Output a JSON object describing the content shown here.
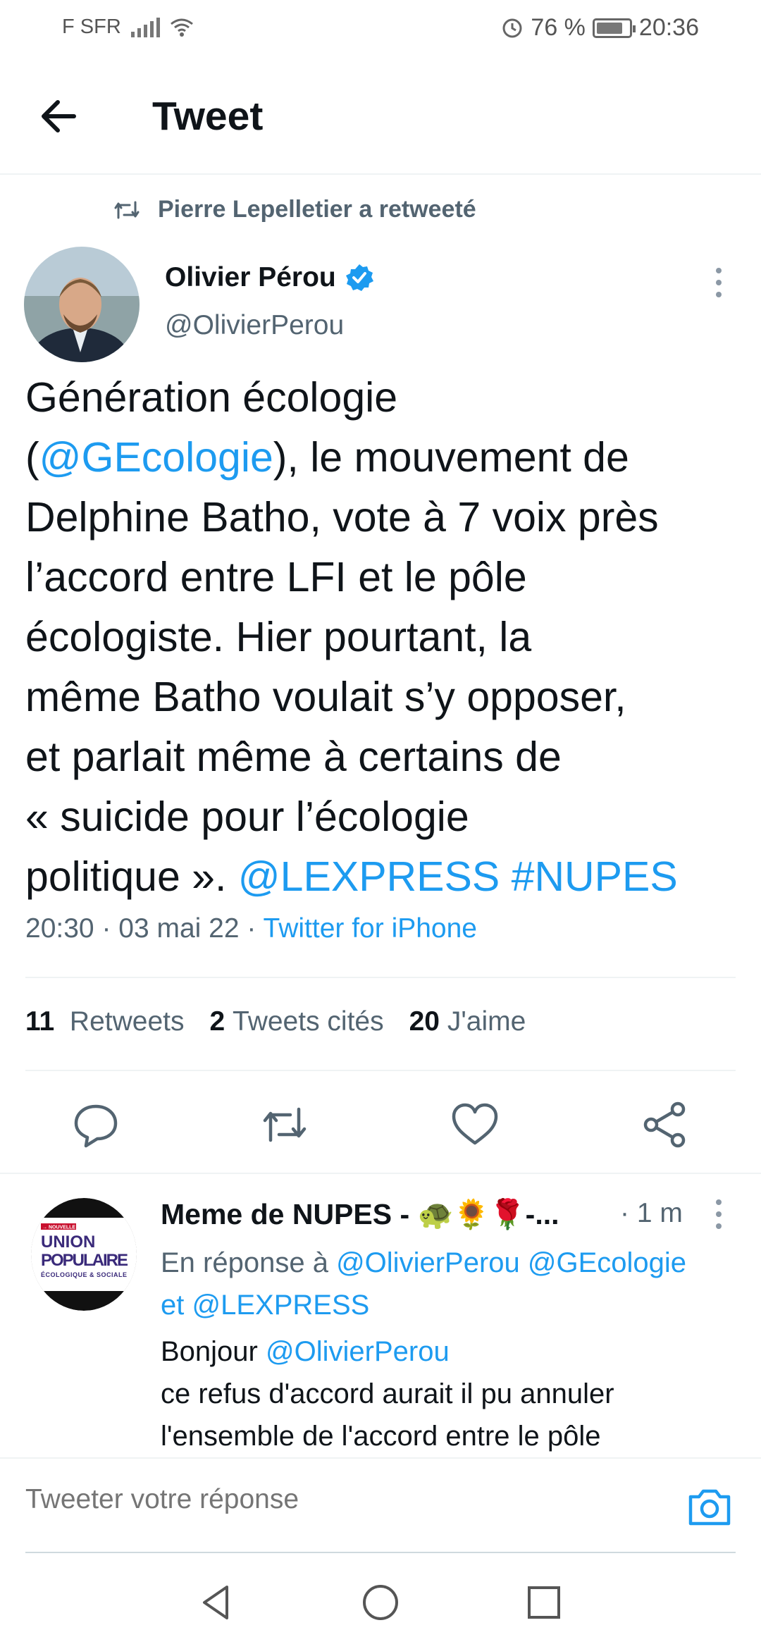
{
  "status_bar": {
    "carrier": "F SFR",
    "battery_percent": "76 %",
    "time": "20:36",
    "battery_level": 0.76
  },
  "header": {
    "title": "Tweet"
  },
  "retweet_line": "Pierre Lepelletier a retweeté",
  "tweet": {
    "author_name": "Olivier Pérou",
    "author_handle": "@OlivierPerou",
    "text_parts": {
      "p1": "Génération écologie",
      "p2": "(",
      "mention_ge": "@GEcologie",
      "p3": "), le mouvement de",
      "p4": "Delphine Batho, vote à 7 voix près",
      "p5": "l’accord entre LFI et le pôle",
      "p6": "écologiste. Hier pourtant, la",
      "p7": "même Batho voulait s’y opposer,",
      "p8": "et parlait même à certains de",
      "p9": "« suicide pour l’écologie",
      "p10": "politique ». ",
      "mention_lexpress": "@LEXPRESS",
      "hashtag": "#NUPES"
    },
    "time": "20:30",
    "date": "03 mai 22",
    "source": "Twitter for iPhone"
  },
  "stats": {
    "retweets_count": "11",
    "retweets_label": "Retweets",
    "quotes_count": "2",
    "quotes_label": "Tweets cités",
    "likes_count": "20",
    "likes_label": "J'aime"
  },
  "reply": {
    "author_display": "Meme de NUPES - 🐢🌻🌹-...",
    "time": "· 1 m",
    "reply_to_prefix": "En réponse à",
    "reply_to_m1": "@OlivierPerou",
    "reply_to_m2": "@GEcologie",
    "reply_to_et": "et",
    "reply_to_m3": "@LEXPRESS",
    "greeting": "Bonjour",
    "greeting_mention": "@OlivierPerou",
    "line2": "ce refus d'accord aurait il pu annuler",
    "line3": "l'ensemble de l'accord entre le pôle",
    "avatar_text": {
      "badge": "→ NOUVELLE",
      "line1": "UNION",
      "line2": "POPULAIRE",
      "line3": "ÉCOLOGIQUE & SOCIALE"
    }
  },
  "compose": {
    "placeholder": "Tweeter votre réponse"
  },
  "colors": {
    "link": "#1d9bf0",
    "muted": "#536471",
    "text": "#0f1419",
    "verified": "#1d9bf0"
  }
}
